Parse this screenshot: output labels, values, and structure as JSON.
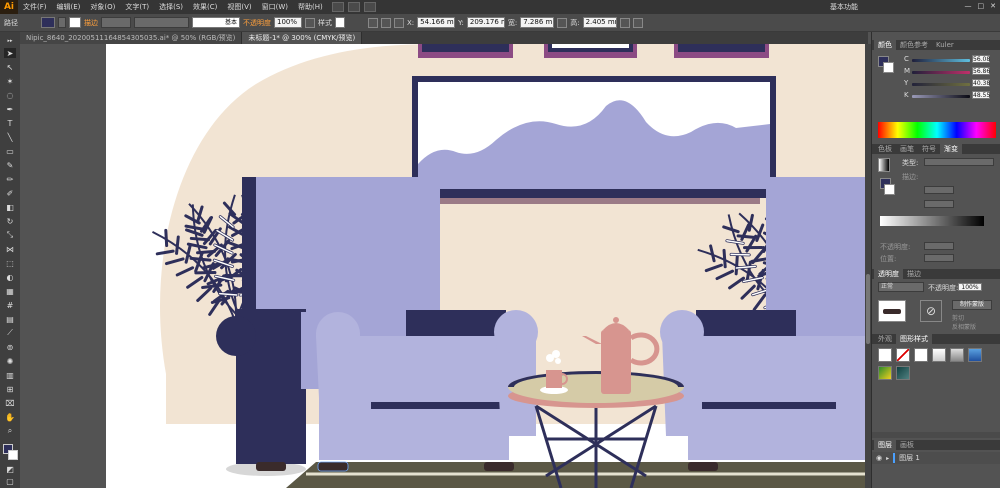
{
  "app": {
    "logo": "Ai",
    "workspace": "基本功能",
    "window_controls": [
      "—",
      "□",
      "✕"
    ]
  },
  "menu": [
    "文件(F)",
    "编辑(E)",
    "对象(O)",
    "文字(T)",
    "选择(S)",
    "效果(C)",
    "视图(V)",
    "窗口(W)",
    "帮助(H)"
  ],
  "control_bar": {
    "selection_label": "路径",
    "brush_label": "基本",
    "opacity_label": "不透明度",
    "opacity_value": "100%",
    "style_label": "样式",
    "x_label": "X:",
    "x_value": "54.166 mm",
    "y_label": "Y:",
    "y_value": "209.176 mm",
    "w_label": "宽:",
    "w_value": "7.286 mm",
    "h_label": "高:",
    "h_value": "2.405 mm"
  },
  "tabs": [
    {
      "label": "Nipic_8640_20200511164854305035.ai* @ 50% (RGB/预览)"
    },
    {
      "label": "未标题-1* @ 300% (CMYK/预览)"
    }
  ],
  "panels": {
    "color": {
      "tabs": [
        "颜色",
        "颜色参考",
        "Kuler"
      ],
      "channels": [
        {
          "label": "C",
          "value": "56.08"
        },
        {
          "label": "M",
          "value": "56.86"
        },
        {
          "label": "Y",
          "value": "40.38"
        },
        {
          "label": "K",
          "value": "48.55"
        }
      ]
    },
    "gradient": {
      "tabs": [
        "色板",
        "画笔",
        "符号",
        "渐变"
      ],
      "type_label": "类型:",
      "stroke_label": "描边:",
      "opacity_label": "不透明度:",
      "location_label": "位置:"
    },
    "transparency": {
      "tabs": [
        "透明度",
        "描边"
      ],
      "mode": "正常",
      "opacity_label": "不透明度:",
      "opacity_value": "100%",
      "make_mask": "制作蒙版",
      "clip": "剪切",
      "invert_mask": "反相蒙版"
    },
    "graphic_styles": {
      "tabs": [
        "外观",
        "图形样式"
      ]
    },
    "layers": {
      "tabs": [
        "图层",
        "画板"
      ],
      "layer_name": "图层 1"
    }
  },
  "colors": {
    "accent": "#ffa03c",
    "navy": "#2e2f5a",
    "lavender": "#a4a5d6",
    "chair_light": "#b2b3dd",
    "beige": "#f2e4d3",
    "salmon": "#d7958f",
    "table_top": "#d5cba7"
  }
}
